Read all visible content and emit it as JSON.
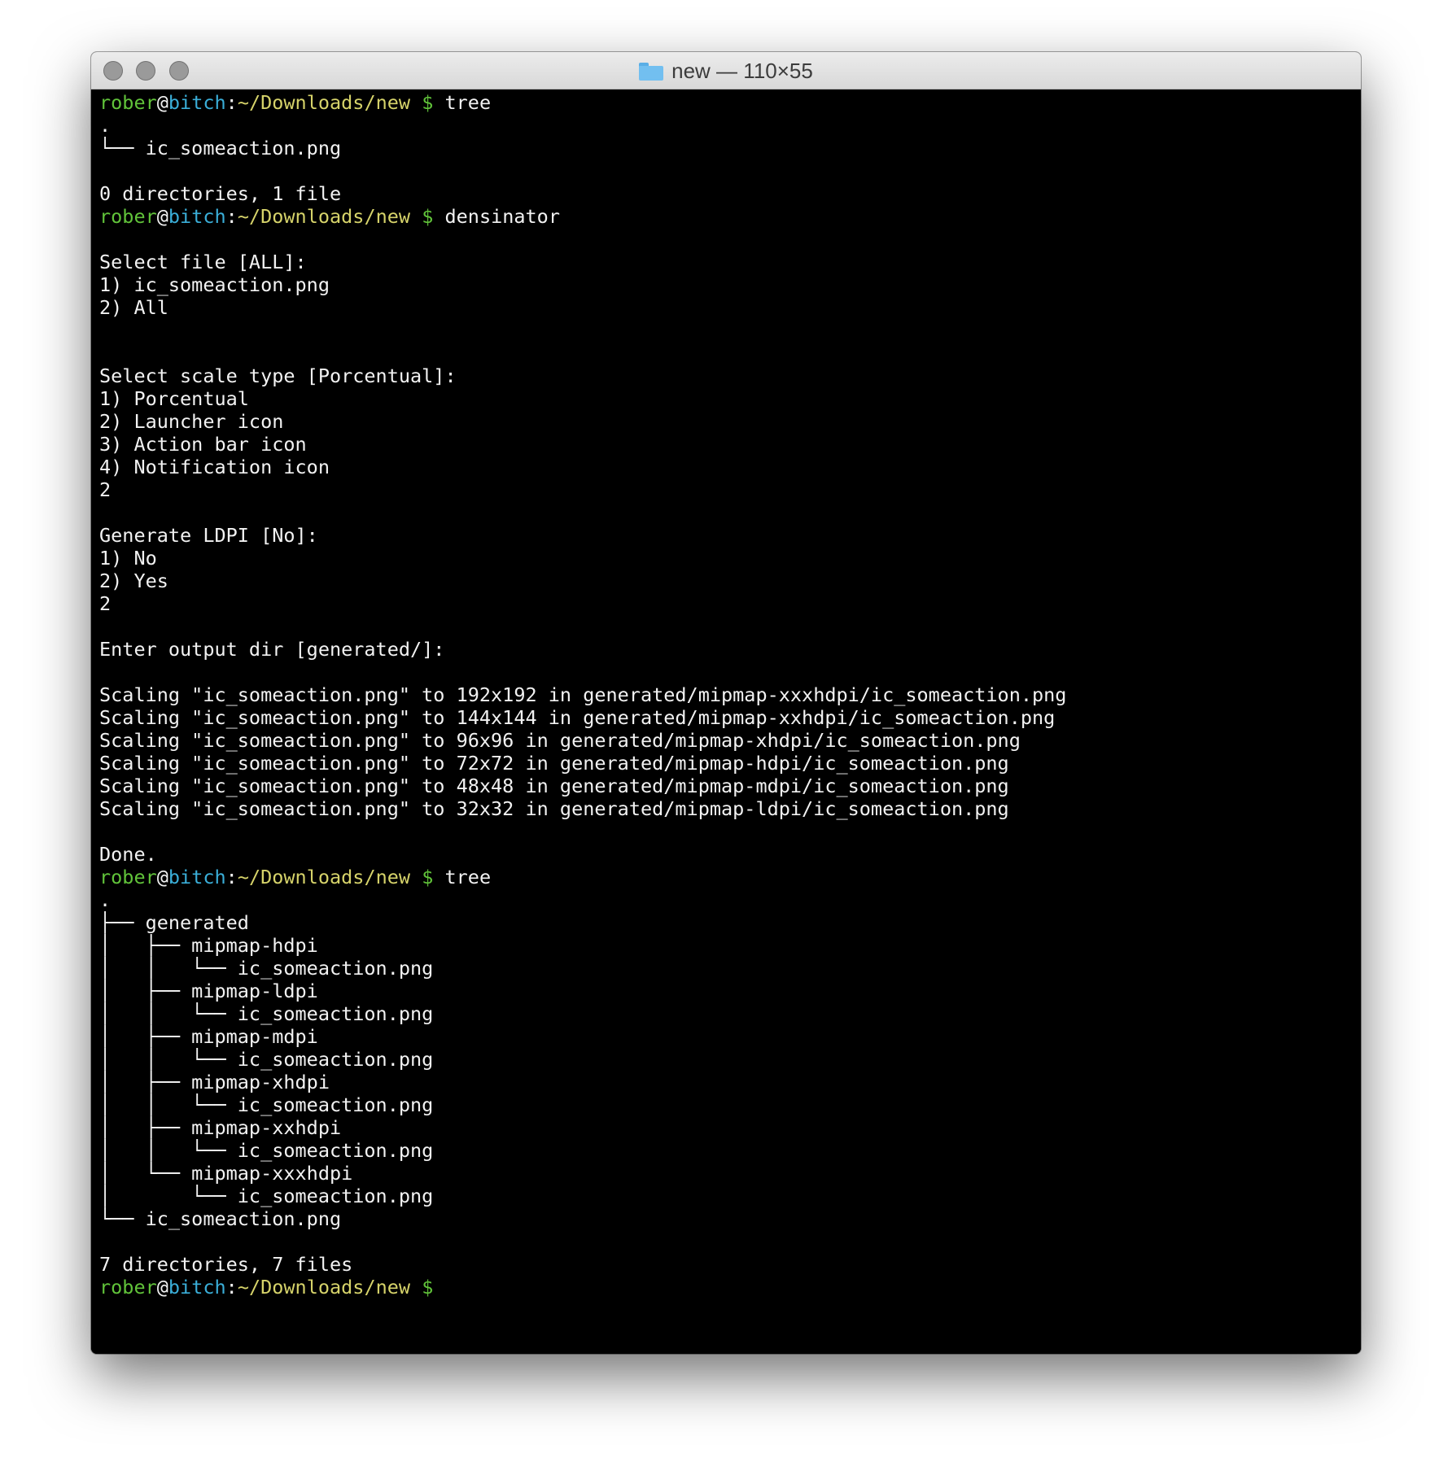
{
  "window": {
    "title": "new — 110×55",
    "folder_icon": "folder-icon"
  },
  "prompt": {
    "user": "rober",
    "at": "@",
    "host": "bitch",
    "colon": ":",
    "path": "~/Downloads/new",
    "dollar": " $ ",
    "colors": {
      "user": "#61c33a",
      "host": "#3aaed8",
      "path": "#d6d36a",
      "dollar": "#61c33a",
      "text": "#f2f2f2",
      "background": "#000000"
    }
  },
  "terminal": {
    "lines": [
      {
        "type": "prompt",
        "command": "tree"
      },
      {
        "type": "output",
        "text": "."
      },
      {
        "type": "output",
        "text": "└── ic_someaction.png"
      },
      {
        "type": "output",
        "text": ""
      },
      {
        "type": "output",
        "text": "0 directories, 1 file"
      },
      {
        "type": "prompt",
        "command": "densinator"
      },
      {
        "type": "output",
        "text": ""
      },
      {
        "type": "output",
        "text": "Select file [ALL]:"
      },
      {
        "type": "output",
        "text": "1) ic_someaction.png"
      },
      {
        "type": "output",
        "text": "2) All"
      },
      {
        "type": "output",
        "text": ""
      },
      {
        "type": "output",
        "text": ""
      },
      {
        "type": "output",
        "text": "Select scale type [Porcentual]:"
      },
      {
        "type": "output",
        "text": "1) Porcentual"
      },
      {
        "type": "output",
        "text": "2) Launcher icon"
      },
      {
        "type": "output",
        "text": "3) Action bar icon"
      },
      {
        "type": "output",
        "text": "4) Notification icon"
      },
      {
        "type": "output",
        "text": "2"
      },
      {
        "type": "output",
        "text": ""
      },
      {
        "type": "output",
        "text": "Generate LDPI [No]:"
      },
      {
        "type": "output",
        "text": "1) No"
      },
      {
        "type": "output",
        "text": "2) Yes"
      },
      {
        "type": "output",
        "text": "2"
      },
      {
        "type": "output",
        "text": ""
      },
      {
        "type": "output",
        "text": "Enter output dir [generated/]:"
      },
      {
        "type": "output",
        "text": ""
      },
      {
        "type": "output",
        "text": "Scaling \"ic_someaction.png\" to 192x192 in generated/mipmap-xxxhdpi/ic_someaction.png"
      },
      {
        "type": "output",
        "text": "Scaling \"ic_someaction.png\" to 144x144 in generated/mipmap-xxhdpi/ic_someaction.png"
      },
      {
        "type": "output",
        "text": "Scaling \"ic_someaction.png\" to 96x96 in generated/mipmap-xhdpi/ic_someaction.png"
      },
      {
        "type": "output",
        "text": "Scaling \"ic_someaction.png\" to 72x72 in generated/mipmap-hdpi/ic_someaction.png"
      },
      {
        "type": "output",
        "text": "Scaling \"ic_someaction.png\" to 48x48 in generated/mipmap-mdpi/ic_someaction.png"
      },
      {
        "type": "output",
        "text": "Scaling \"ic_someaction.png\" to 32x32 in generated/mipmap-ldpi/ic_someaction.png"
      },
      {
        "type": "output",
        "text": ""
      },
      {
        "type": "output",
        "text": "Done."
      },
      {
        "type": "prompt",
        "command": "tree"
      },
      {
        "type": "output",
        "text": "."
      },
      {
        "type": "output",
        "text": "├── generated"
      },
      {
        "type": "output",
        "text": "│   ├── mipmap-hdpi"
      },
      {
        "type": "output",
        "text": "│   │   └── ic_someaction.png"
      },
      {
        "type": "output",
        "text": "│   ├── mipmap-ldpi"
      },
      {
        "type": "output",
        "text": "│   │   └── ic_someaction.png"
      },
      {
        "type": "output",
        "text": "│   ├── mipmap-mdpi"
      },
      {
        "type": "output",
        "text": "│   │   └── ic_someaction.png"
      },
      {
        "type": "output",
        "text": "│   ├── mipmap-xhdpi"
      },
      {
        "type": "output",
        "text": "│   │   └── ic_someaction.png"
      },
      {
        "type": "output",
        "text": "│   ├── mipmap-xxhdpi"
      },
      {
        "type": "output",
        "text": "│   │   └── ic_someaction.png"
      },
      {
        "type": "output",
        "text": "│   └── mipmap-xxxhdpi"
      },
      {
        "type": "output",
        "text": "│       └── ic_someaction.png"
      },
      {
        "type": "output",
        "text": "└── ic_someaction.png"
      },
      {
        "type": "output",
        "text": ""
      },
      {
        "type": "output",
        "text": "7 directories, 7 files"
      },
      {
        "type": "prompt",
        "command": ""
      }
    ]
  }
}
